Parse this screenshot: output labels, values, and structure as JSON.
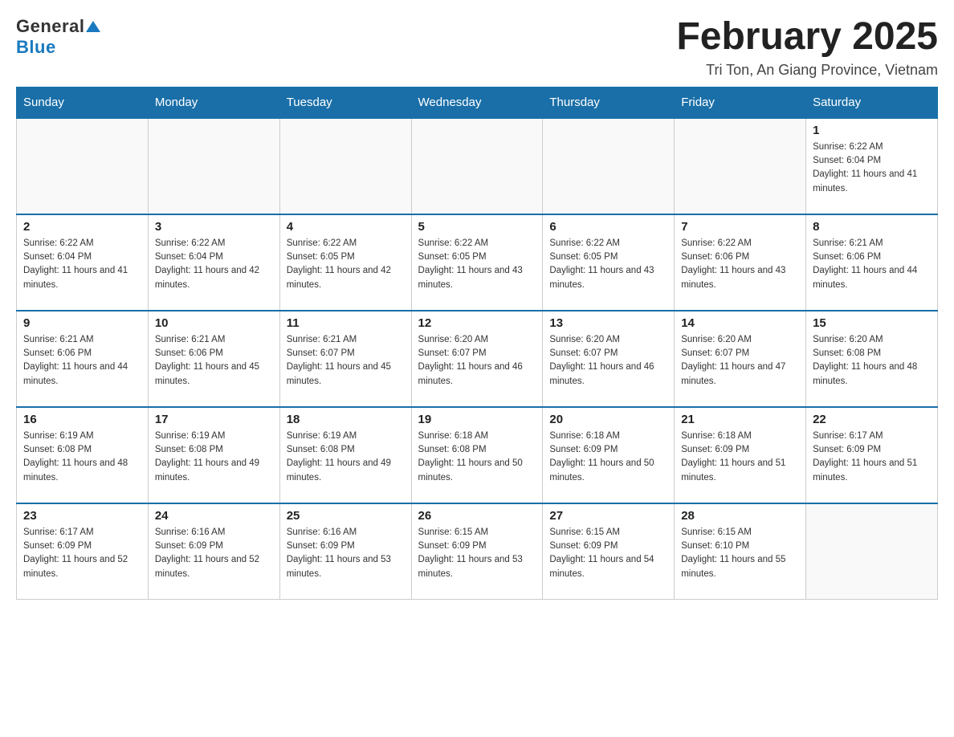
{
  "header": {
    "logo_general": "General",
    "logo_blue": "Blue",
    "month_title": "February 2025",
    "location": "Tri Ton, An Giang Province, Vietnam"
  },
  "days_of_week": [
    "Sunday",
    "Monday",
    "Tuesday",
    "Wednesday",
    "Thursday",
    "Friday",
    "Saturday"
  ],
  "weeks": [
    [
      {
        "day": "",
        "sunrise": "",
        "sunset": "",
        "daylight": ""
      },
      {
        "day": "",
        "sunrise": "",
        "sunset": "",
        "daylight": ""
      },
      {
        "day": "",
        "sunrise": "",
        "sunset": "",
        "daylight": ""
      },
      {
        "day": "",
        "sunrise": "",
        "sunset": "",
        "daylight": ""
      },
      {
        "day": "",
        "sunrise": "",
        "sunset": "",
        "daylight": ""
      },
      {
        "day": "",
        "sunrise": "",
        "sunset": "",
        "daylight": ""
      },
      {
        "day": "1",
        "sunrise": "Sunrise: 6:22 AM",
        "sunset": "Sunset: 6:04 PM",
        "daylight": "Daylight: 11 hours and 41 minutes."
      }
    ],
    [
      {
        "day": "2",
        "sunrise": "Sunrise: 6:22 AM",
        "sunset": "Sunset: 6:04 PM",
        "daylight": "Daylight: 11 hours and 41 minutes."
      },
      {
        "day": "3",
        "sunrise": "Sunrise: 6:22 AM",
        "sunset": "Sunset: 6:04 PM",
        "daylight": "Daylight: 11 hours and 42 minutes."
      },
      {
        "day": "4",
        "sunrise": "Sunrise: 6:22 AM",
        "sunset": "Sunset: 6:05 PM",
        "daylight": "Daylight: 11 hours and 42 minutes."
      },
      {
        "day": "5",
        "sunrise": "Sunrise: 6:22 AM",
        "sunset": "Sunset: 6:05 PM",
        "daylight": "Daylight: 11 hours and 43 minutes."
      },
      {
        "day": "6",
        "sunrise": "Sunrise: 6:22 AM",
        "sunset": "Sunset: 6:05 PM",
        "daylight": "Daylight: 11 hours and 43 minutes."
      },
      {
        "day": "7",
        "sunrise": "Sunrise: 6:22 AM",
        "sunset": "Sunset: 6:06 PM",
        "daylight": "Daylight: 11 hours and 43 minutes."
      },
      {
        "day": "8",
        "sunrise": "Sunrise: 6:21 AM",
        "sunset": "Sunset: 6:06 PM",
        "daylight": "Daylight: 11 hours and 44 minutes."
      }
    ],
    [
      {
        "day": "9",
        "sunrise": "Sunrise: 6:21 AM",
        "sunset": "Sunset: 6:06 PM",
        "daylight": "Daylight: 11 hours and 44 minutes."
      },
      {
        "day": "10",
        "sunrise": "Sunrise: 6:21 AM",
        "sunset": "Sunset: 6:06 PM",
        "daylight": "Daylight: 11 hours and 45 minutes."
      },
      {
        "day": "11",
        "sunrise": "Sunrise: 6:21 AM",
        "sunset": "Sunset: 6:07 PM",
        "daylight": "Daylight: 11 hours and 45 minutes."
      },
      {
        "day": "12",
        "sunrise": "Sunrise: 6:20 AM",
        "sunset": "Sunset: 6:07 PM",
        "daylight": "Daylight: 11 hours and 46 minutes."
      },
      {
        "day": "13",
        "sunrise": "Sunrise: 6:20 AM",
        "sunset": "Sunset: 6:07 PM",
        "daylight": "Daylight: 11 hours and 46 minutes."
      },
      {
        "day": "14",
        "sunrise": "Sunrise: 6:20 AM",
        "sunset": "Sunset: 6:07 PM",
        "daylight": "Daylight: 11 hours and 47 minutes."
      },
      {
        "day": "15",
        "sunrise": "Sunrise: 6:20 AM",
        "sunset": "Sunset: 6:08 PM",
        "daylight": "Daylight: 11 hours and 48 minutes."
      }
    ],
    [
      {
        "day": "16",
        "sunrise": "Sunrise: 6:19 AM",
        "sunset": "Sunset: 6:08 PM",
        "daylight": "Daylight: 11 hours and 48 minutes."
      },
      {
        "day": "17",
        "sunrise": "Sunrise: 6:19 AM",
        "sunset": "Sunset: 6:08 PM",
        "daylight": "Daylight: 11 hours and 49 minutes."
      },
      {
        "day": "18",
        "sunrise": "Sunrise: 6:19 AM",
        "sunset": "Sunset: 6:08 PM",
        "daylight": "Daylight: 11 hours and 49 minutes."
      },
      {
        "day": "19",
        "sunrise": "Sunrise: 6:18 AM",
        "sunset": "Sunset: 6:08 PM",
        "daylight": "Daylight: 11 hours and 50 minutes."
      },
      {
        "day": "20",
        "sunrise": "Sunrise: 6:18 AM",
        "sunset": "Sunset: 6:09 PM",
        "daylight": "Daylight: 11 hours and 50 minutes."
      },
      {
        "day": "21",
        "sunrise": "Sunrise: 6:18 AM",
        "sunset": "Sunset: 6:09 PM",
        "daylight": "Daylight: 11 hours and 51 minutes."
      },
      {
        "day": "22",
        "sunrise": "Sunrise: 6:17 AM",
        "sunset": "Sunset: 6:09 PM",
        "daylight": "Daylight: 11 hours and 51 minutes."
      }
    ],
    [
      {
        "day": "23",
        "sunrise": "Sunrise: 6:17 AM",
        "sunset": "Sunset: 6:09 PM",
        "daylight": "Daylight: 11 hours and 52 minutes."
      },
      {
        "day": "24",
        "sunrise": "Sunrise: 6:16 AM",
        "sunset": "Sunset: 6:09 PM",
        "daylight": "Daylight: 11 hours and 52 minutes."
      },
      {
        "day": "25",
        "sunrise": "Sunrise: 6:16 AM",
        "sunset": "Sunset: 6:09 PM",
        "daylight": "Daylight: 11 hours and 53 minutes."
      },
      {
        "day": "26",
        "sunrise": "Sunrise: 6:15 AM",
        "sunset": "Sunset: 6:09 PM",
        "daylight": "Daylight: 11 hours and 53 minutes."
      },
      {
        "day": "27",
        "sunrise": "Sunrise: 6:15 AM",
        "sunset": "Sunset: 6:09 PM",
        "daylight": "Daylight: 11 hours and 54 minutes."
      },
      {
        "day": "28",
        "sunrise": "Sunrise: 6:15 AM",
        "sunset": "Sunset: 6:10 PM",
        "daylight": "Daylight: 11 hours and 55 minutes."
      },
      {
        "day": "",
        "sunrise": "",
        "sunset": "",
        "daylight": ""
      }
    ]
  ]
}
